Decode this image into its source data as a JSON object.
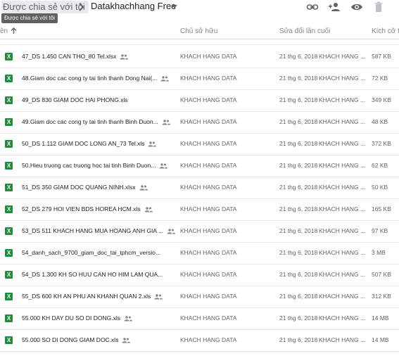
{
  "breadcrumb": {
    "parent": "Được chia sẻ với tôi",
    "current": "Datakhachhang Free"
  },
  "tooltip": "Được chia sẻ với tôi",
  "toolbar": {
    "link_icon": "link-icon",
    "share_icon": "add-person-icon",
    "preview_icon": "eye-icon",
    "delete_icon": "trash-icon"
  },
  "columns": {
    "name": "ên",
    "owner": "Chủ sở hữu",
    "modified": "Sửa đổi lần cuối",
    "size": "Kích cỡ tệp"
  },
  "colors": {
    "excel": "#1e8e3e",
    "accent": "#1a73e8"
  },
  "files": [
    {
      "name": "47_DS 1.450 CAN THO_80 Tel.xlsx",
      "owner": "KHACH HANG DATA",
      "date": "21 thg 6, 2018",
      "by": "KHACH HANG ...",
      "size": "587 KB"
    },
    {
      "name": "48.Giam doc cac cong ty tai tinh thanh Dong Nai(...",
      "owner": "KHACH HANG DATA",
      "date": "21 thg 6, 2018",
      "by": "KHACH HANG ...",
      "size": "72 KB"
    },
    {
      "name": "49_DS 830 GIAM DOC HAI PHONG.xls",
      "owner": "KHACH HANG DATA",
      "date": "21 thg 6, 2018",
      "by": "KHACH HANG ...",
      "size": "349 KB"
    },
    {
      "name": "49.Giam doc cac cong ty tai tinh thanh Binh Duon...",
      "owner": "KHACH HANG DATA",
      "date": "21 thg 6, 2018",
      "by": "KHACH HANG ...",
      "size": "48 KB"
    },
    {
      "name": "50_DS 1.112 GIAM DOC LONG AN_73 Tel.xls",
      "owner": "KHACH HANG DATA",
      "date": "21 thg 6, 2018",
      "by": "KHACH HANG ...",
      "size": "372 KB"
    },
    {
      "name": "50.Hieu truong cac truong hoc tai tinh Binh Duon...",
      "owner": "KHACH HANG DATA",
      "date": "21 thg 6, 2018",
      "by": "KHACH HANG ...",
      "size": "62 KB"
    },
    {
      "name": "51_DS 350 GIAM DOC QUANG NINH.xlsx",
      "owner": "KHACH HANG DATA",
      "date": "21 thg 6, 2018",
      "by": "KHACH HANG ...",
      "size": "50 KB"
    },
    {
      "name": "52_DS 279 HOI VIEN BDS HOREA HCM.xls",
      "owner": "KHACH HANG DATA",
      "date": "21 thg 6, 2018",
      "by": "KHACH HANG ...",
      "size": "165 KB"
    },
    {
      "name": "53_DS 511 KHACH HANG MUA HOANG ANH GIA ...",
      "owner": "KHACH HANG DATA",
      "date": "21 thg 6, 2018",
      "by": "KHACH HANG ...",
      "size": "97 KB"
    },
    {
      "name": "54_danh_sach_9700_giam_doc_tai_tphcm_versio...",
      "owner": "KHACH HANG DATA",
      "date": "21 thg 6, 2018",
      "by": "KHACH HANG ...",
      "size": "3 MB"
    },
    {
      "name": "54_DS 1.300 KH SO HUU CAN HO HIM LAM QUA...",
      "owner": "KHACH HANG DATA",
      "date": "21 thg 6, 2018",
      "by": "KHACH HANG ...",
      "size": "507 KB"
    },
    {
      "name": "55_DS 600 KH AN PHU AN KHANH QUAN 2.xls",
      "owner": "KHACH HANG DATA",
      "date": "21 thg 6, 2018",
      "by": "KHACH HANG ...",
      "size": "312 KB"
    },
    {
      "name": "55.000 KH DAY DU SO DI DONG.xls",
      "owner": "KHACH HANG DATA",
      "date": "21 thg 6, 2018",
      "by": "KHACH HANG ...",
      "size": "14 MB"
    },
    {
      "name": "55.000 SO DI DONG GIAM DOC.xls",
      "owner": "KHACH HANG DATA",
      "date": "21 thg 6, 2018",
      "by": "KHACH HANG ...",
      "size": "14 MB"
    }
  ]
}
